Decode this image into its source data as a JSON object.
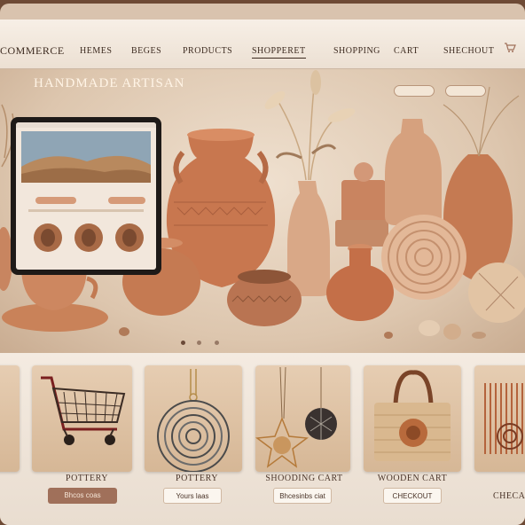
{
  "nav": {
    "brand": "COMMERCE",
    "items": [
      "HEMES",
      "BEGES",
      "PRODUCTS",
      "SHOPPERET",
      "SHOPPING",
      "CART",
      "SHECHOUT"
    ],
    "active_index": 3
  },
  "hero": {
    "title": "HANDMADE  ARTISAN",
    "pills": [
      "",
      ""
    ],
    "carousel_dots": 3,
    "carousel_active": 0
  },
  "products": {
    "cards": [
      {
        "name": "cart",
        "label": "POTTERY",
        "button": "Bhcos coas",
        "button_style": "dark"
      },
      {
        "name": "spiral-pendant",
        "label": "POTTERY",
        "button": "Yours laas",
        "button_style": "light"
      },
      {
        "name": "star-pendant",
        "label": "SHOODING CART",
        "button": "Bhcesinbs ciat",
        "button_style": "light"
      },
      {
        "name": "basket",
        "label": "WOODEN CART",
        "button": "CHECKOUT",
        "button_style": "light"
      },
      {
        "name": "weaving",
        "label": "",
        "button": "CHECA",
        "button_style": "none"
      }
    ]
  },
  "colors": {
    "accent": "#a0705a",
    "terracotta": "#c57a52",
    "nav_bg": "#f7efe6"
  }
}
